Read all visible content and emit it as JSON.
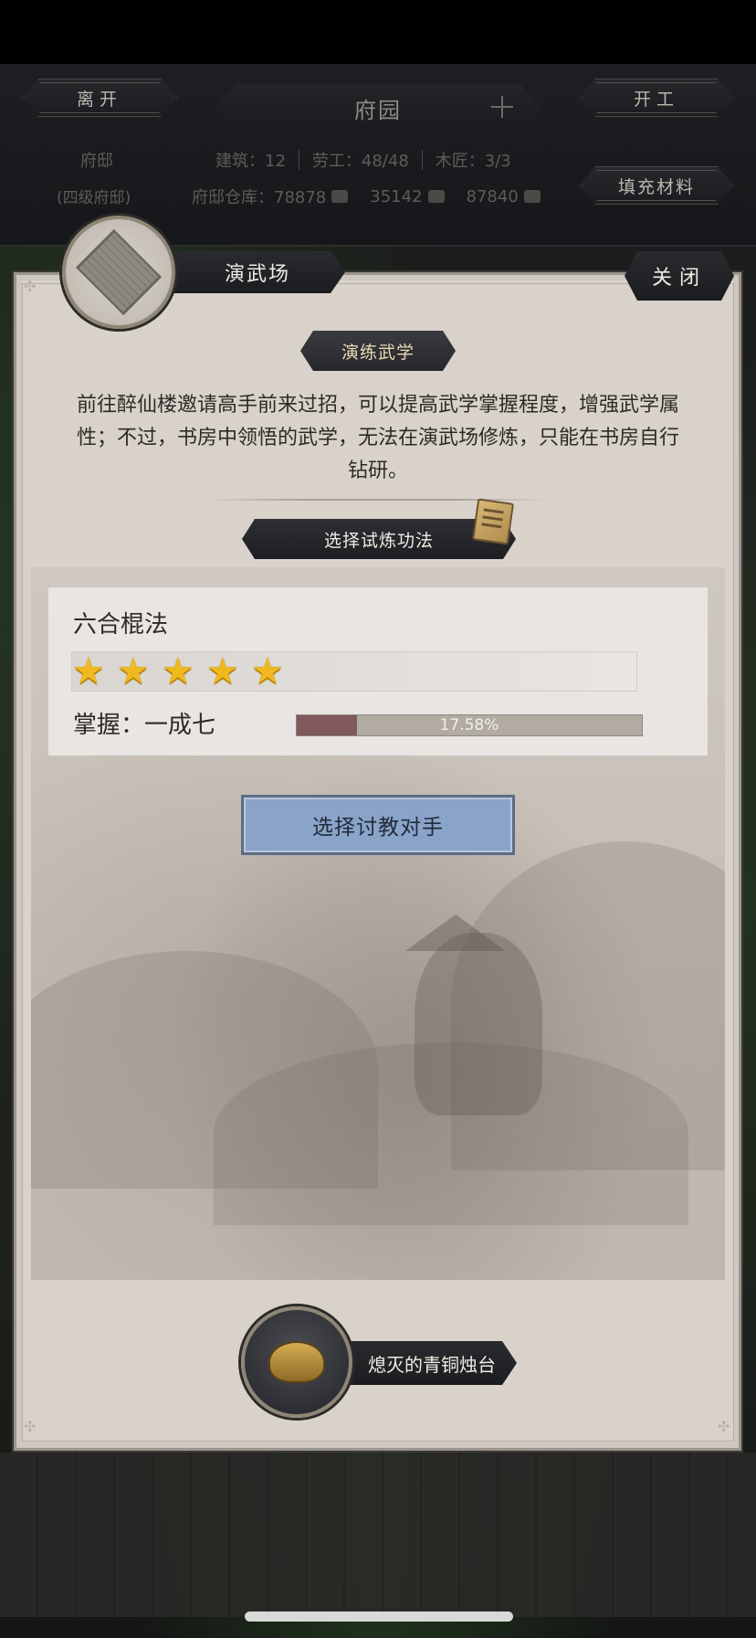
{
  "topbar": {
    "leave_label": "离开",
    "title": "府园",
    "start_work_label": "开工",
    "fill_materials_label": "填充材料",
    "residence_name": "府邸",
    "residence_level": "(四级府邸)",
    "stats": {
      "building": "建筑：12",
      "labor": "劳工：48/48",
      "carpenter": "木匠：3/3"
    },
    "warehouse": {
      "label": "府邸仓库：78878",
      "value2": "35142",
      "value3": "87840"
    }
  },
  "panel": {
    "building_name": "演武场",
    "close_label": "关闭",
    "section_title": "演练武学",
    "description": "前往醉仙楼邀请高手前来过招，可以提高武学掌握程度，增强武学属性；不过，书房中领悟的武学，无法在演武场修炼，只能在书房自行钻研。",
    "select_technique_label": "选择试炼功法",
    "skill": {
      "name": "六合棍法",
      "stars": 5,
      "mastery_label": "掌握：一成七",
      "progress_percent": 17.58,
      "progress_text": "17.58%"
    },
    "select_opponent_label": "选择讨教对手",
    "item_name": "熄灭的青铜烛台"
  },
  "colors": {
    "progress_fill": "#80595c",
    "opponent_button": "#8aa3c8",
    "star": "#f1b920"
  },
  "icons": [
    "plus-icon",
    "arena-icon",
    "book-icon",
    "star-icon",
    "bronze-candlestick-icon",
    "coin-icon",
    "brush-icon",
    "scroll-icon"
  ]
}
